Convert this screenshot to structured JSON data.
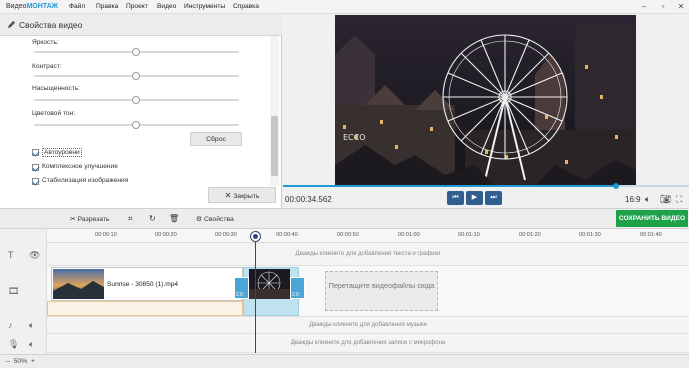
{
  "app": {
    "logo_a": "Видео",
    "logo_b": "МОНТАЖ",
    "menu": [
      "Файл",
      "Правка",
      "Проект",
      "Видео",
      "Инструменты",
      "Справка"
    ]
  },
  "panel": {
    "title": "Свойства видео",
    "sliders": [
      {
        "label": "Яркость:",
        "value": 0.5
      },
      {
        "label": "Контраст:",
        "value": 0.5
      },
      {
        "label": "Насыщенность:",
        "value": 0.5
      },
      {
        "label": "Цветовой тон:",
        "value": 0.5
      }
    ],
    "reset_label": "Сброс",
    "checkboxes": [
      {
        "label": "Автоуровни",
        "checked": true
      },
      {
        "label": "Комплексное улучшение",
        "checked": true
      },
      {
        "label": "Стабилизация изображения",
        "checked": true
      }
    ],
    "close_label": "Закрыть"
  },
  "player": {
    "timecode": "00:00:34.562",
    "progress": 0.82,
    "aspect": "16:9"
  },
  "toolbar": {
    "cut_label": "Разрезать",
    "props_label": "Свойства",
    "save_label": "СОХРАНИТЬ ВИДЕО"
  },
  "timeline": {
    "ticks": [
      "00:00:10",
      "00:00:20",
      "00:00:30",
      "00:00:40",
      "00:00:50",
      "00:01:00",
      "00:01:10",
      "00:01:20",
      "00:01:30",
      "00:01:40"
    ],
    "text_hint": "Дважды кликните для добавления текста и графики",
    "clip1_name": "Sunrise - 30850 (1).mp4",
    "clip_badge_a": "2.0",
    "clip_badge_b": "2.0",
    "dropzone_label": "Перетащите видеофайлы сюда",
    "music_hint": "Дважды кликните для добавления музыки",
    "mic_hint": "Дважды кликните для добавления записи с микрофона",
    "zoom": "50%"
  },
  "colors": {
    "accent": "#1e9bd7",
    "save": "#1da24a",
    "play_buttons": "#2f5f8f"
  }
}
